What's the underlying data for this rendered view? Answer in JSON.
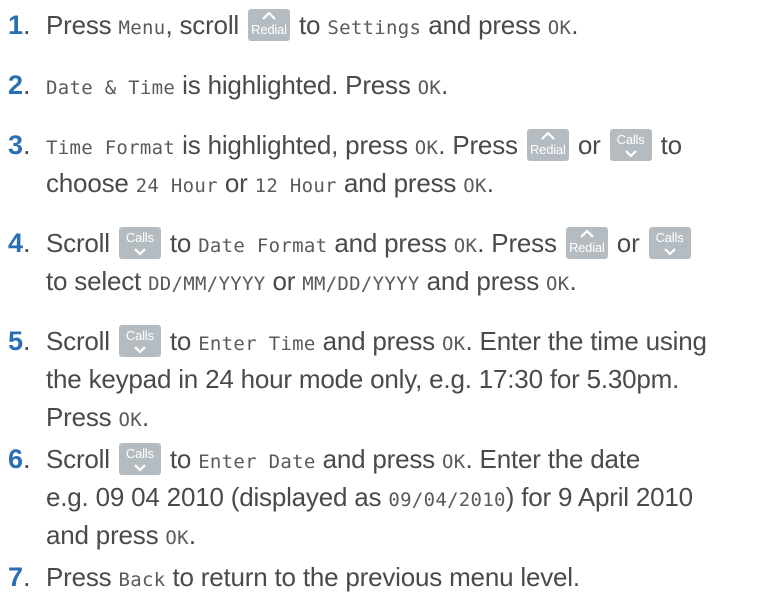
{
  "keys": {
    "redial": "Redial",
    "calls": "Calls"
  },
  "steps": [
    {
      "number": "1",
      "dot": ".",
      "l1": {
        "a": "Press ",
        "b": "Menu",
        "c": ", scroll ",
        "d": " to ",
        "e": "Settings",
        "f": " and press ",
        "g": "OK",
        "h": "."
      }
    },
    {
      "number": "2",
      "dot": ".",
      "l1": {
        "a": "Date & Time",
        "b": " is highlighted. Press ",
        "c": "OK",
        "d": "."
      }
    },
    {
      "number": "3",
      "dot": ".",
      "l1": {
        "a": "Time Format",
        "b": " is highlighted, press ",
        "c": "OK",
        "d": ". Press ",
        "e": " or ",
        "f": " to"
      },
      "l2": {
        "a": "choose ",
        "b": "24 Hour",
        "c": " or ",
        "d": "12 Hour",
        "e": " and press ",
        "f": "OK",
        "g": "."
      }
    },
    {
      "number": "4",
      "dot": ".",
      "l1": {
        "a": "Scroll ",
        "b": " to ",
        "c": "Date Format",
        "d": " and press ",
        "e": "OK",
        "f": ". Press ",
        "g": " or "
      },
      "l2": {
        "a": "to select ",
        "b": "DD/MM/YYYY",
        "c": " or ",
        "d": "MM/DD/YYYY",
        "e": " and press ",
        "f": "OK",
        "g": "."
      }
    },
    {
      "number": "5",
      "dot": ".",
      "l1": {
        "a": "Scroll ",
        "b": " to ",
        "c": "Enter Time",
        "d": " and press ",
        "e": "OK",
        "f": ". Enter the time using"
      },
      "l2": {
        "a": "the keypad in 24 hour mode only, e.g. 17:30 for 5.30pm."
      },
      "l3": {
        "a": "Press ",
        "b": "OK",
        "c": "."
      }
    },
    {
      "number": "6",
      "dot": ".",
      "l1": {
        "a": "Scroll ",
        "b": " to ",
        "c": "Enter Date",
        "d": " and press ",
        "e": "OK",
        "f": ". Enter the date"
      },
      "l2": {
        "a": "e.g. 09 04 2010 (displayed as ",
        "b": "09/04/2010",
        "c": ") for 9 April 2010"
      },
      "l3": {
        "a": "and press ",
        "b": "OK",
        "c": "."
      }
    },
    {
      "number": "7",
      "dot": ".",
      "l1": {
        "a": "Press ",
        "b": "Back",
        "c": " to return to the previous menu level."
      }
    }
  ]
}
